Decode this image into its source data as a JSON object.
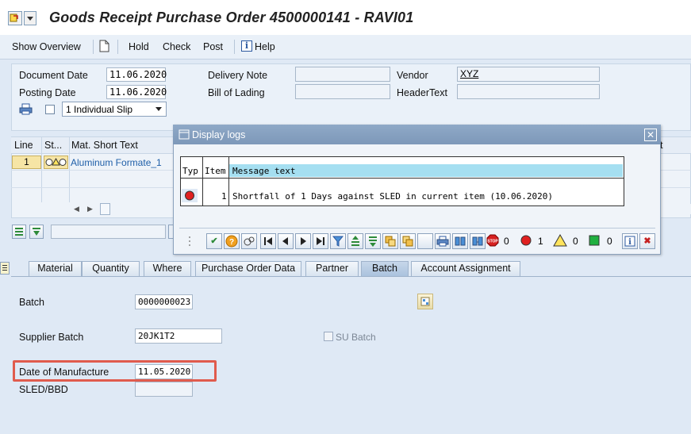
{
  "window": {
    "title": "Goods Receipt Purchase Order 4500000141 - RAVI01",
    "icon": "sap-transaction-icon"
  },
  "toolbar": {
    "show_overview": "Show Overview",
    "hold": "Hold",
    "check": "Check",
    "post": "Post",
    "help": "Help"
  },
  "header": {
    "document_date_label": "Document Date",
    "document_date": "11.06.2020",
    "posting_date_label": "Posting Date",
    "posting_date": "11.06.2020",
    "slip_option": "1 Individual Slip",
    "delivery_note_label": "Delivery Note",
    "bill_of_lading_label": "Bill of Lading",
    "vendor_label": "Vendor",
    "vendor": "XYZ",
    "header_text_label": "HeaderText"
  },
  "items": {
    "columns": [
      "Line",
      "St...",
      "Mat. Short Text"
    ],
    "column_truncated": "t",
    "rows": [
      {
        "line": "1",
        "status_icon": "traffic-light-icon",
        "text": "Aluminum Formate_1"
      }
    ]
  },
  "dialog": {
    "title": "Display logs",
    "columns": [
      "Typ",
      "Item",
      "Message text"
    ],
    "rows": [
      {
        "type_icon": "red-error-icon",
        "item": "1",
        "message": "Shortfall of 1 Days against SLED in current item (10.06.2020)"
      }
    ],
    "counts": {
      "stop": "0",
      "error": "1",
      "warning": "0",
      "success": "0"
    }
  },
  "tabs": [
    "Material",
    "Quantity",
    "Where",
    "Purchase Order Data",
    "Partner",
    "Batch",
    "Account Assignment"
  ],
  "active_tab": "Batch",
  "batch": {
    "batch_label": "Batch",
    "batch": "0000000023",
    "supplier_batch_label": "Supplier Batch",
    "supplier_batch": "20JK1T2",
    "su_batch_label": "SU Batch",
    "date_of_manufacture_label": "Date of Manufacture",
    "date_of_manufacture": "11.05.2020",
    "sled_label": "SLED/BBD",
    "sled": ""
  },
  "colors": {
    "highlight": "#e05b4d",
    "background": "#dfe9f5",
    "dialog_header": "#7d98b9",
    "table_header": "#a5dff1",
    "link": "#1f5fa8"
  }
}
